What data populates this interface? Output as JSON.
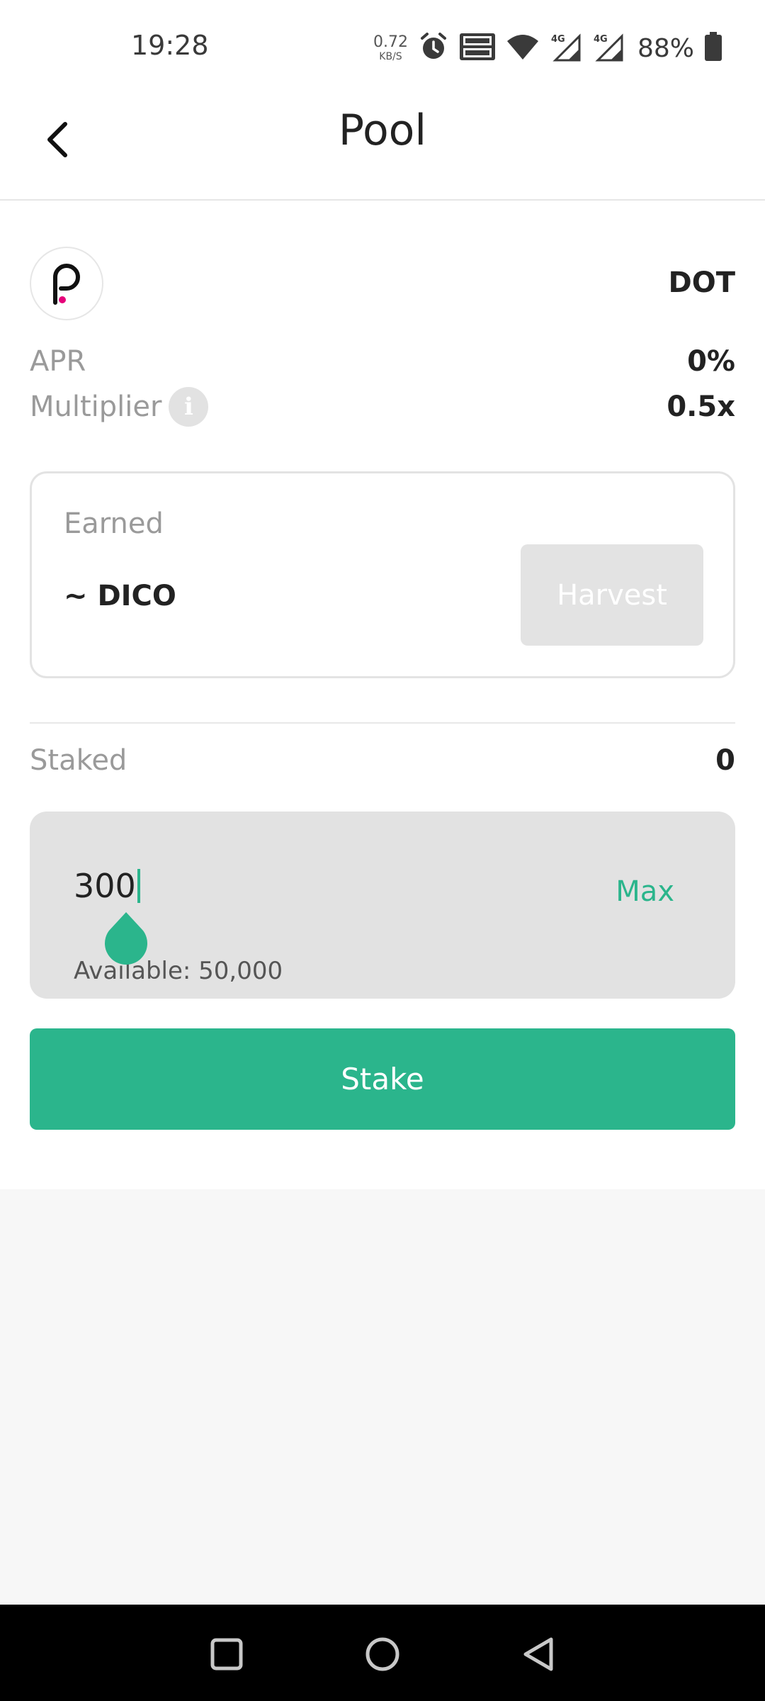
{
  "status_bar": {
    "time": "19:28",
    "net_speed_value": "0.72",
    "net_speed_unit": "KB/S",
    "battery_percent": "88%"
  },
  "header": {
    "title": "Pool"
  },
  "token": {
    "symbol": "DOT"
  },
  "stats": {
    "apr_label": "APR",
    "apr_value": "0%",
    "multiplier_label": "Multiplier",
    "multiplier_value": "0.5x"
  },
  "earned": {
    "label": "Earned",
    "value": "~ DICO",
    "harvest_label": "Harvest"
  },
  "staked": {
    "label": "Staked",
    "value": "0"
  },
  "stake_input": {
    "value": "300",
    "max_label": "Max",
    "available_text": "Available: 50,000"
  },
  "stake_button": {
    "label": "Stake"
  },
  "colors": {
    "accent": "#2bb58c",
    "polkadot_pink": "#e6007a"
  }
}
